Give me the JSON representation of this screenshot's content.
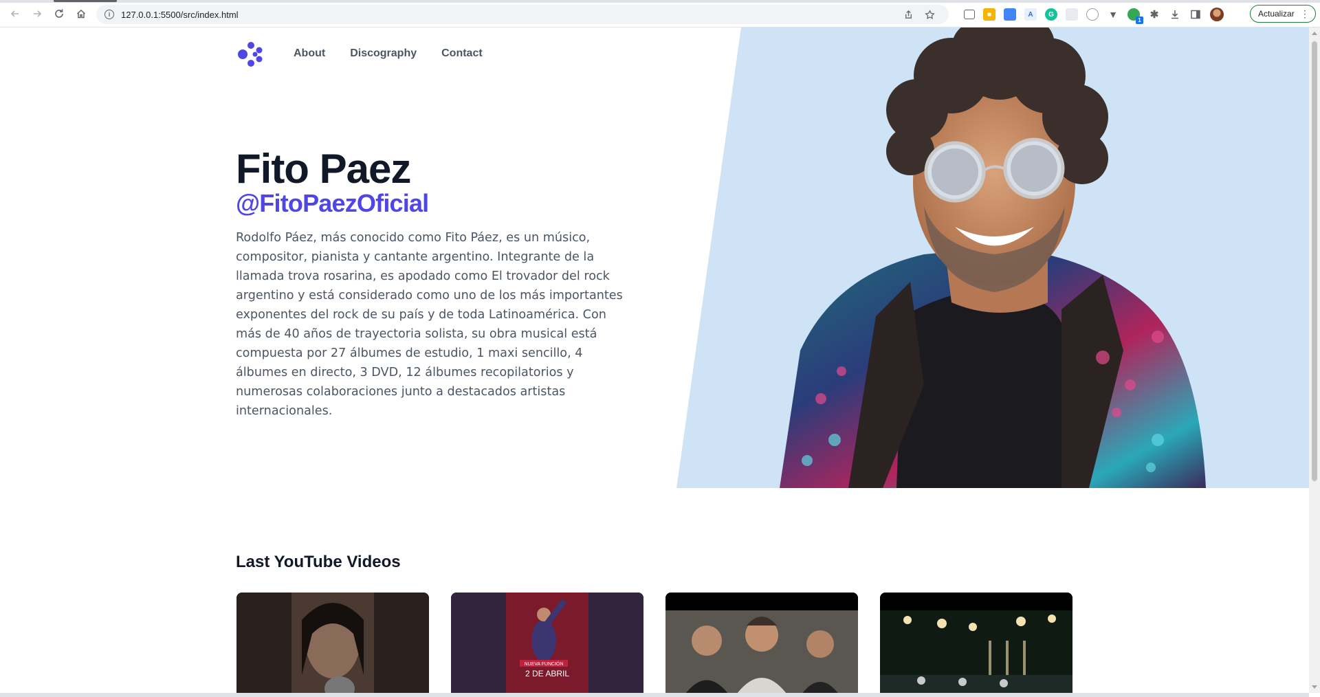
{
  "browser": {
    "url": "127.0.0.1:5500/src/index.html",
    "update_label": "Actualizar",
    "extension_badge": "1"
  },
  "nav": {
    "links": [
      "About",
      "Discography",
      "Contact"
    ]
  },
  "hero": {
    "title": "Fito Paez",
    "handle": "@FitoPaezOficial",
    "description": "Rodolfo Páez, más conocido como Fito Páez, es un músico, compositor, pianista y cantante argentino. Integrante de la llamada trova rosarina, es apodado como El trovador del rock argentino y está considerado como uno de los más importantes exponentes del rock de su país y de toda Latinoamérica. Con más de 40 años de trayectoria solista, su obra musical está compuesta por 27 álbumes de estudio, 1 maxi sencillo, 4 álbumes en directo, 3 DVD, 12 álbumes recopilatorios y numerosas colaboraciones junto a destacados artistas internacionales."
  },
  "videos_section": {
    "title": "Last YouTube Videos",
    "thumb2_caption_top": "NUEVA FUNCIÓN",
    "thumb2_caption_bottom": "2 DE ABRIL"
  },
  "colors": {
    "accent": "#4f46e5",
    "heading": "#111827",
    "body_text": "#4b5563",
    "hero_bg": "#cfe3f6"
  }
}
